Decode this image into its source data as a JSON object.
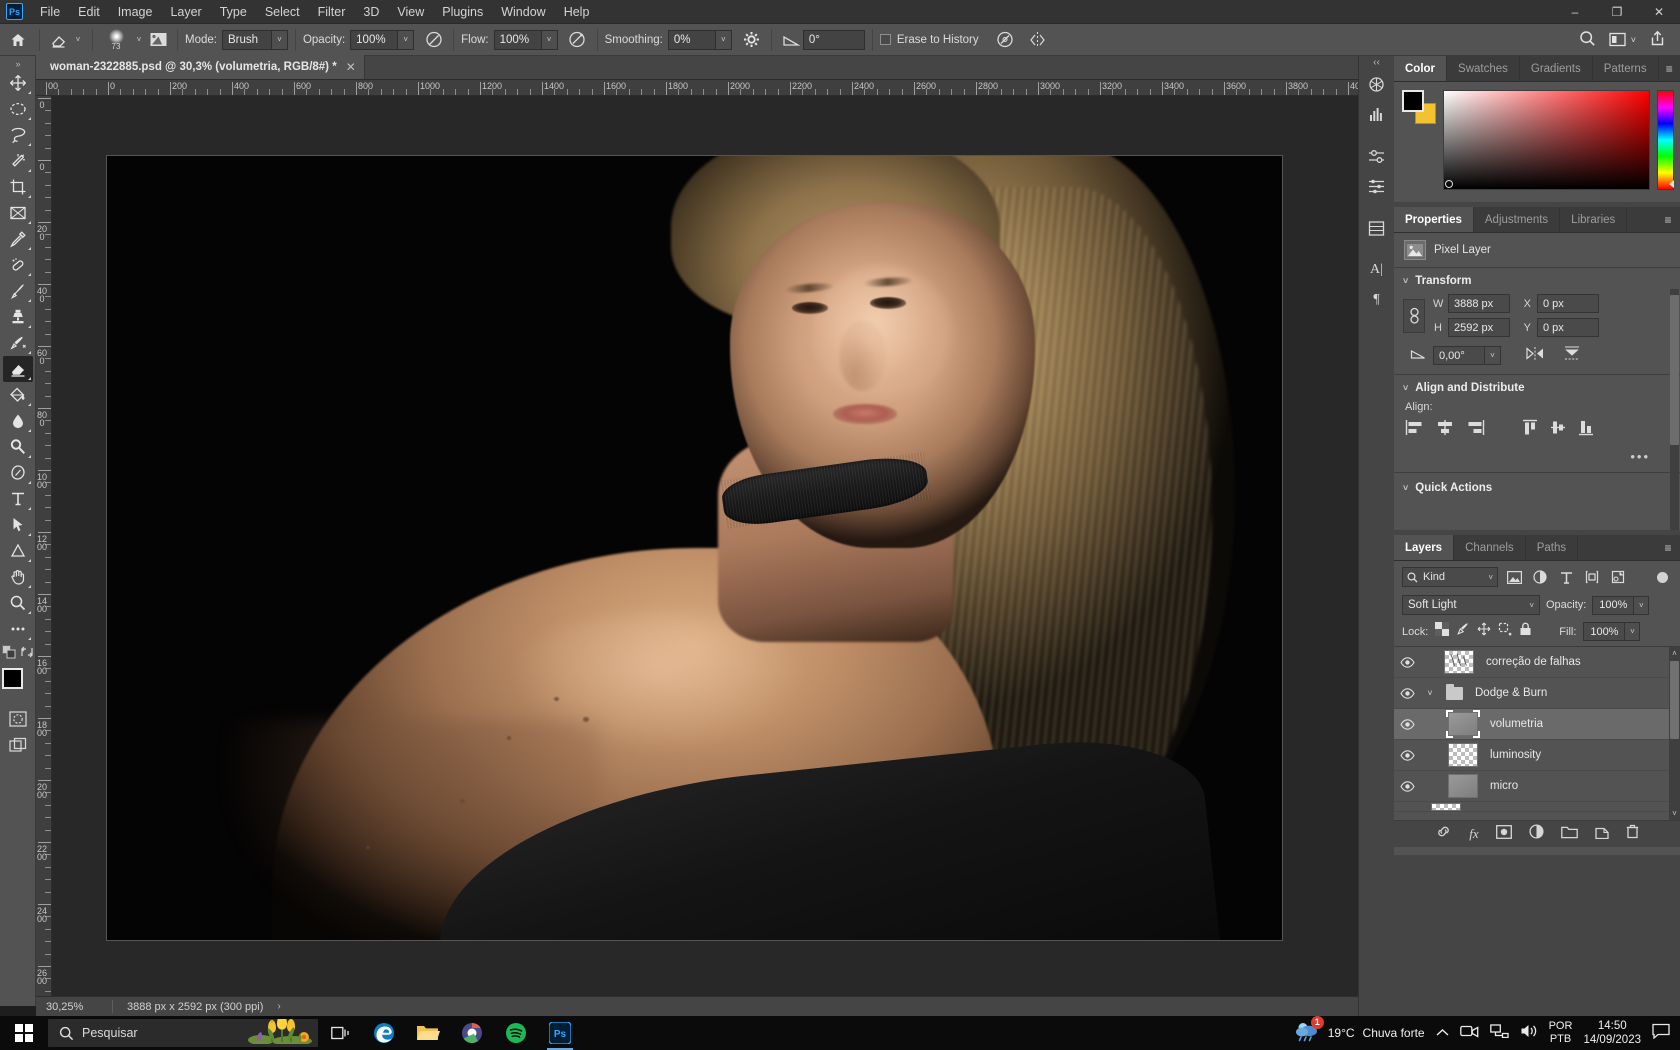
{
  "menubar": {
    "logo": "Ps",
    "items": [
      "File",
      "Edit",
      "Image",
      "Layer",
      "Type",
      "Select",
      "Filter",
      "3D",
      "View",
      "Plugins",
      "Window",
      "Help"
    ],
    "window_buttons": {
      "minimize": "–",
      "maximize": "❐",
      "close": "✕"
    }
  },
  "options_bar": {
    "brush_size": "73",
    "mode_label": "Mode:",
    "mode_value": "Brush",
    "opacity_label": "Opacity:",
    "opacity_value": "100%",
    "flow_label": "Flow:",
    "flow_value": "100%",
    "smoothing_label": "Smoothing:",
    "smoothing_value": "0%",
    "angle_value": "0°",
    "erase_to_history_label": "Erase to History"
  },
  "document": {
    "tab_title": "woman-2322885.psd @ 30,3% (volumetria, RGB/8#) *",
    "tab_close": "✕"
  },
  "rulers": {
    "horizontal_labels": [
      "00",
      "0",
      "200",
      "400",
      "600",
      "800",
      "1000",
      "1200",
      "1400",
      "1600",
      "1800",
      "2000",
      "2200",
      "2400",
      "2600",
      "2800",
      "3000",
      "3200",
      "3400",
      "3600",
      "3800",
      "40"
    ],
    "vertical_labels": [
      "0",
      "0",
      "2 0 0",
      "4 0 0",
      "6 0 0",
      "8 0 0",
      "1 0 0 0",
      "1 2 0 0",
      "1 4 0 0",
      "1 6 0 0",
      "1 8 0 0",
      "2 0 0 0",
      "2 2 0 0",
      "2 4 0 0",
      "2 6 0 0"
    ]
  },
  "status_bar": {
    "zoom": "30,25%",
    "dimensions": "3888 px x 2592 px (300 ppi)",
    "arrow": "›"
  },
  "color_panel": {
    "tabs": [
      "Color",
      "Swatches",
      "Gradients",
      "Patterns"
    ],
    "active_tab": "Color",
    "foreground_color": "#000000",
    "background_color": "#f2c230"
  },
  "properties_panel": {
    "tabs": [
      "Properties",
      "Adjustments",
      "Libraries"
    ],
    "active_tab": "Properties",
    "layer_type": "Pixel Layer",
    "transform": {
      "title": "Transform",
      "w_label": "W",
      "w_value": "3888 px",
      "h_label": "H",
      "h_value": "2592 px",
      "x_label": "X",
      "x_value": "0 px",
      "y_label": "Y",
      "y_value": "0 px",
      "angle_value": "0,00°"
    },
    "align": {
      "title": "Align and Distribute",
      "align_label": "Align:",
      "more": "•••"
    },
    "quick_actions": {
      "title": "Quick Actions"
    }
  },
  "layers_panel": {
    "tabs": [
      "Layers",
      "Channels",
      "Paths"
    ],
    "active_tab": "Layers",
    "filter_kind": "Kind",
    "blend_mode": "Soft Light",
    "opacity_label": "Opacity:",
    "opacity_value": "100%",
    "lock_label": "Lock:",
    "fill_label": "Fill:",
    "fill_value": "100%",
    "layers": [
      {
        "name": "correção de falhas",
        "visible": true,
        "selected": false,
        "type": "pixel",
        "thumb": "checker",
        "indent": 0
      },
      {
        "name": "Dodge & Burn",
        "visible": true,
        "selected": false,
        "type": "group",
        "thumb": "folder",
        "indent": 0
      },
      {
        "name": "volumetria",
        "visible": true,
        "selected": true,
        "type": "pixel",
        "thumb": "gray",
        "indent": 1
      },
      {
        "name": "luminosity",
        "visible": true,
        "selected": false,
        "type": "pixel",
        "thumb": "checker",
        "indent": 1
      },
      {
        "name": "micro",
        "visible": true,
        "selected": false,
        "type": "pixel",
        "thumb": "gray",
        "indent": 1
      }
    ]
  },
  "taskbar": {
    "search_placeholder": "Pesquisar",
    "weather_temp": "19°C",
    "weather_desc": "Chuva forte",
    "weather_badge": "1",
    "language_line1": "POR",
    "language_line2": "PTB",
    "clock_time": "14:50",
    "clock_date": "14/09/2023"
  }
}
